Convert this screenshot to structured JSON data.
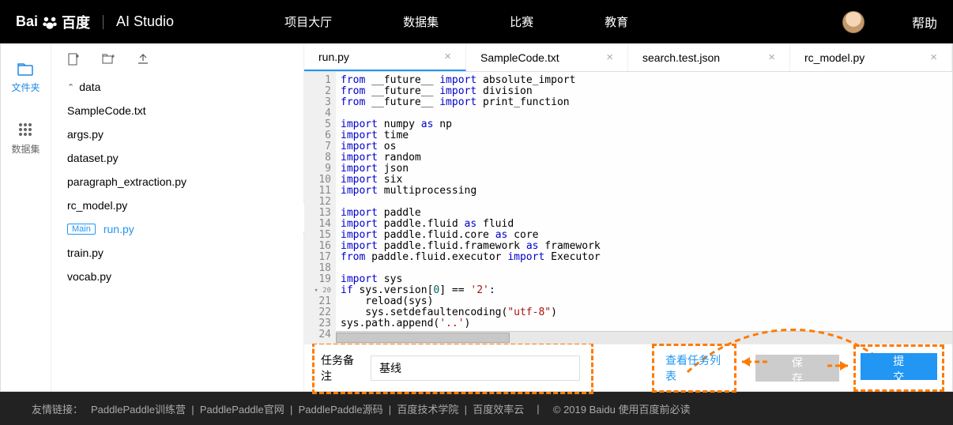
{
  "header": {
    "brand_baidu": "百度",
    "brand_studio": "AI Studio",
    "nav": [
      "项目大厅",
      "数据集",
      "比赛",
      "教育"
    ],
    "help": "帮助"
  },
  "left_rail": {
    "files": "文件夹",
    "datasets": "数据集"
  },
  "sidebar": {
    "folder": "data",
    "files": [
      {
        "name": "SampleCode.txt",
        "main": false
      },
      {
        "name": "args.py",
        "main": false
      },
      {
        "name": "dataset.py",
        "main": false
      },
      {
        "name": "paragraph_extraction.py",
        "main": false
      },
      {
        "name": "rc_model.py",
        "main": false
      },
      {
        "name": "run.py",
        "main": true,
        "active": true
      },
      {
        "name": "train.py",
        "main": false
      },
      {
        "name": "vocab.py",
        "main": false
      }
    ],
    "main_badge": "Main"
  },
  "tabs": [
    {
      "label": "run.py",
      "active": true
    },
    {
      "label": "SampleCode.txt"
    },
    {
      "label": "search.test.json"
    },
    {
      "label": "rc_model.py"
    }
  ],
  "code_lines": [
    {
      "n": 1,
      "html": "<span class='kw-blue'>from</span> __future__ <span class='kw-blue'>import</span> absolute_import"
    },
    {
      "n": 2,
      "html": "<span class='kw-blue'>from</span> __future__ <span class='kw-blue'>import</span> division"
    },
    {
      "n": 3,
      "html": "<span class='kw-blue'>from</span> __future__ <span class='kw-blue'>import</span> print_function"
    },
    {
      "n": 4,
      "html": ""
    },
    {
      "n": 5,
      "html": "<span class='kw-blue'>import</span> numpy <span class='kw-blue'>as</span> np"
    },
    {
      "n": 6,
      "html": "<span class='kw-blue'>import</span> time"
    },
    {
      "n": 7,
      "html": "<span class='kw-blue'>import</span> os"
    },
    {
      "n": 8,
      "html": "<span class='kw-blue'>import</span> random"
    },
    {
      "n": 9,
      "html": "<span class='kw-blue'>import</span> json"
    },
    {
      "n": 10,
      "html": "<span class='kw-blue'>import</span> six"
    },
    {
      "n": 11,
      "html": "<span class='kw-blue'>import</span> multiprocessing"
    },
    {
      "n": 12,
      "html": ""
    },
    {
      "n": 13,
      "html": "<span class='kw-blue'>import</span> paddle"
    },
    {
      "n": 14,
      "html": "<span class='kw-blue'>import</span> paddle.fluid <span class='kw-blue'>as</span> fluid"
    },
    {
      "n": 15,
      "html": "<span class='kw-blue'>import</span> paddle.fluid.core <span class='kw-blue'>as</span> core"
    },
    {
      "n": 16,
      "html": "<span class='kw-blue'>import</span> paddle.fluid.framework <span class='kw-blue'>as</span> framework"
    },
    {
      "n": 17,
      "html": "<span class='kw-blue'>from</span> paddle.fluid.executor <span class='kw-blue'>import</span> Executor"
    },
    {
      "n": 18,
      "html": ""
    },
    {
      "n": 19,
      "html": "<span class='kw-blue'>import</span> sys"
    },
    {
      "n": 20,
      "html": "<span class='kw-blue'>if</span> sys.version[<span class='num'>0</span>] == <span class='str'>'2'</span>:",
      "fold": true
    },
    {
      "n": 21,
      "html": "    reload(sys)"
    },
    {
      "n": 22,
      "html": "    sys.setdefaultencoding(<span class='str'>\"utf-8\"</span>)"
    },
    {
      "n": 23,
      "html": "sys.path.append(<span class='str'>'..'</span>)"
    },
    {
      "n": 24,
      "html": ""
    }
  ],
  "bottom": {
    "remark_label": "任务备注",
    "remark_value": "基线",
    "view_tasks": "查看任务列表",
    "save": "保 存",
    "submit": "提 交"
  },
  "footer": {
    "prefix": "友情链接：",
    "links": [
      "PaddlePaddle训练营",
      "PaddlePaddle官网",
      "PaddlePaddle源码",
      "百度技术学院",
      "百度效率云"
    ],
    "copyright": "© 2019 Baidu 使用百度前必读"
  }
}
